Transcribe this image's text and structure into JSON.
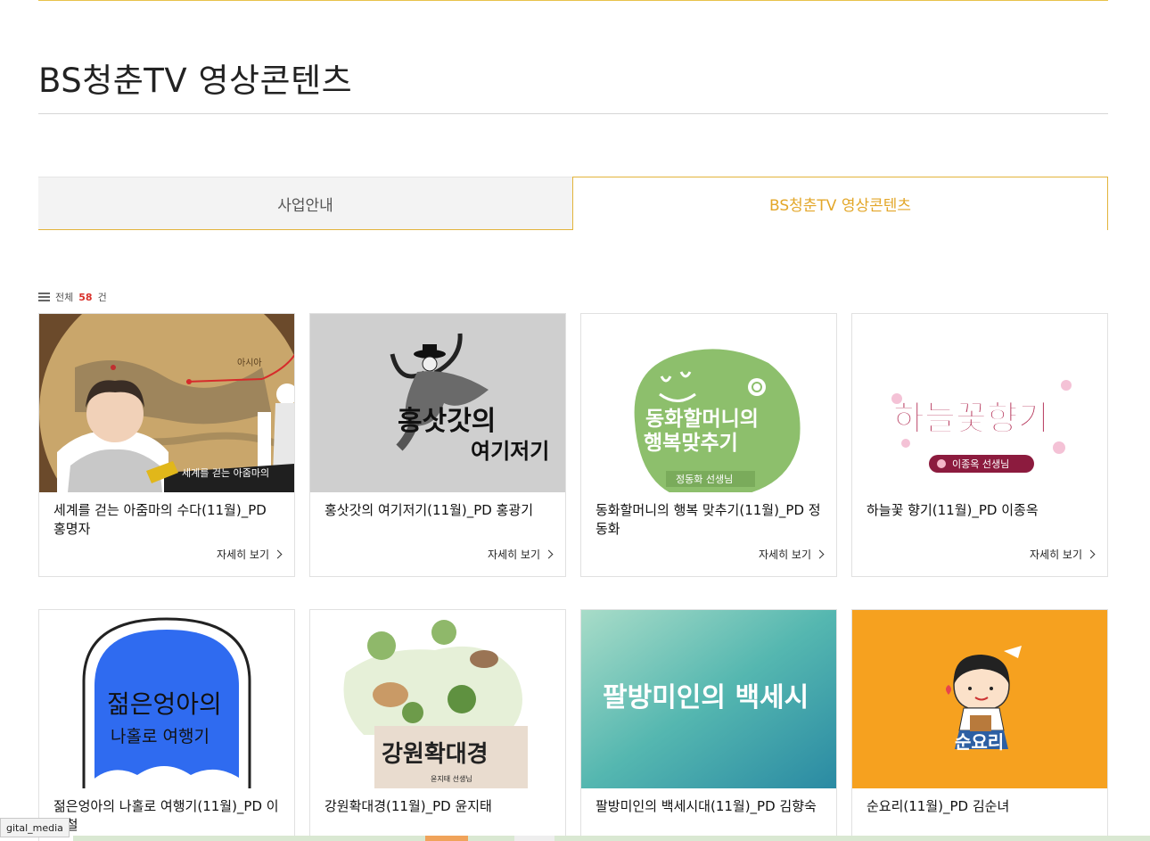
{
  "page": {
    "title": "BS청춘TV 영상콘텐츠"
  },
  "tabs": [
    {
      "label": "사업안내",
      "active": false
    },
    {
      "label": "BS청춘TV 영상콘텐츠",
      "active": true
    }
  ],
  "count": {
    "prefix": "전체",
    "value": "58",
    "suffix": "건"
  },
  "cards": [
    {
      "title": "세계를 걷는 아줌마의 수다(11월)_PD 홍명자",
      "more": "자세히 보기",
      "thumb_text": "세계를 걷는 아줌마의"
    },
    {
      "title": "홍삿갓의 여기저기(11월)_PD 홍광기",
      "more": "자세히 보기",
      "thumb_text": "홍삿갓의"
    },
    {
      "title": "동화할머니의 행복 맞추기(11월)_PD 정동화",
      "more": "자세히 보기",
      "thumb_text": "동화할머니의"
    },
    {
      "title": "하늘꽃 향기(11월)_PD 이종옥",
      "more": "자세히 보기",
      "thumb_text": "하늘꽃향기"
    },
    {
      "title": "젊은엉아의 나홀로 여행기(11월)_PD 이병철",
      "more": "",
      "thumb_text": "젊은엉아의"
    },
    {
      "title": "강원확대경(11월)_PD 윤지태",
      "more": "",
      "thumb_text": "강원확대경"
    },
    {
      "title": "팔방미인의 백세시대(11월)_PD 김향숙",
      "more": "",
      "thumb_text": "팔방미인의 백세시"
    },
    {
      "title": "순요리(11월)_PD 김순녀",
      "more": "",
      "thumb_text": "순요리"
    }
  ],
  "thumb_extra": {
    "c1_asia": "아시아",
    "c2_line2": "여기저기",
    "c3_line2": "행복맞추기",
    "c3_teacher": "정동화 선생님",
    "c4_teacher": "이종옥 선생님",
    "c5_line2": "나홀로 여행기",
    "c6_teacher": "윤지태 선생님"
  },
  "statusbar": {
    "text": "gital_media"
  },
  "colors": {
    "accent": "#e3a72a",
    "count_number": "#d9312b",
    "border": "#e1e1e1"
  }
}
